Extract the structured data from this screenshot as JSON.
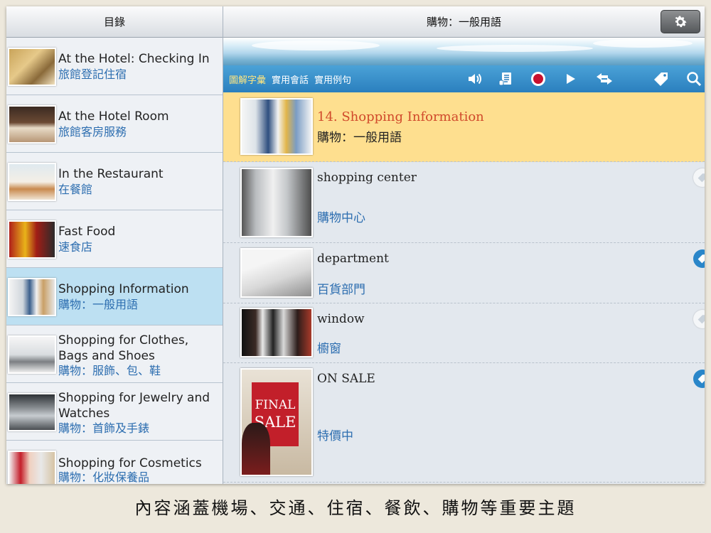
{
  "sidebar": {
    "header": "目錄",
    "items": [
      {
        "en": "At the Hotel: Checking In",
        "zh": "旅館登記住宿",
        "selected": false
      },
      {
        "en": "At the Hotel Room",
        "zh": "旅館客房服務",
        "selected": false
      },
      {
        "en": "In the Restaurant",
        "zh": "在餐館",
        "selected": false
      },
      {
        "en": "Fast Food",
        "zh": "速食店",
        "selected": false
      },
      {
        "en": "Shopping Information",
        "zh": "購物：一般用語",
        "selected": true
      },
      {
        "en": "Shopping for Clothes, Bags and Shoes",
        "zh": "購物：服飾、包、鞋",
        "selected": false
      },
      {
        "en": "Shopping for Jewelry and Watches",
        "zh": "購物：首飾及手錶",
        "selected": false
      },
      {
        "en": "Shopping for Cosmetics",
        "zh": "購物：化妝保養品",
        "selected": false
      }
    ]
  },
  "main": {
    "header": "購物：一般用語",
    "settings_icon": "gear-icon",
    "tabs": [
      {
        "label": "圖解字彙",
        "active": true
      },
      {
        "label": "實用會話",
        "active": false
      },
      {
        "label": "實用例句",
        "active": false
      }
    ],
    "toolbar_icons": [
      "speaker-icon",
      "script-icon",
      "record-icon",
      "play-icon",
      "swap-icon",
      "tag-icon",
      "search-icon"
    ],
    "lesson": {
      "title": "14. Shopping Information",
      "subtitle": "購物：一般用語"
    },
    "entries": [
      {
        "en": "shopping center",
        "zh": "購物中心",
        "tagged": false
      },
      {
        "en": "department",
        "zh": "百貨部門",
        "tagged": true
      },
      {
        "en": "window",
        "zh": "櫥窗",
        "tagged": false
      },
      {
        "en": "ON SALE",
        "zh": "特價中",
        "tagged": true
      }
    ],
    "sale_sign": {
      "line1": "FINAL",
      "line2": "SALE"
    }
  },
  "caption": "內容涵蓋機場、交通、住宿、餐飲、購物等重要主題",
  "colors": {
    "accent_blue": "#2a7fbe",
    "selected_row": "#bde0f2",
    "lesson_bg": "#fedf8f",
    "lesson_title": "#d0492b",
    "zh_text": "#2d6eb0"
  }
}
